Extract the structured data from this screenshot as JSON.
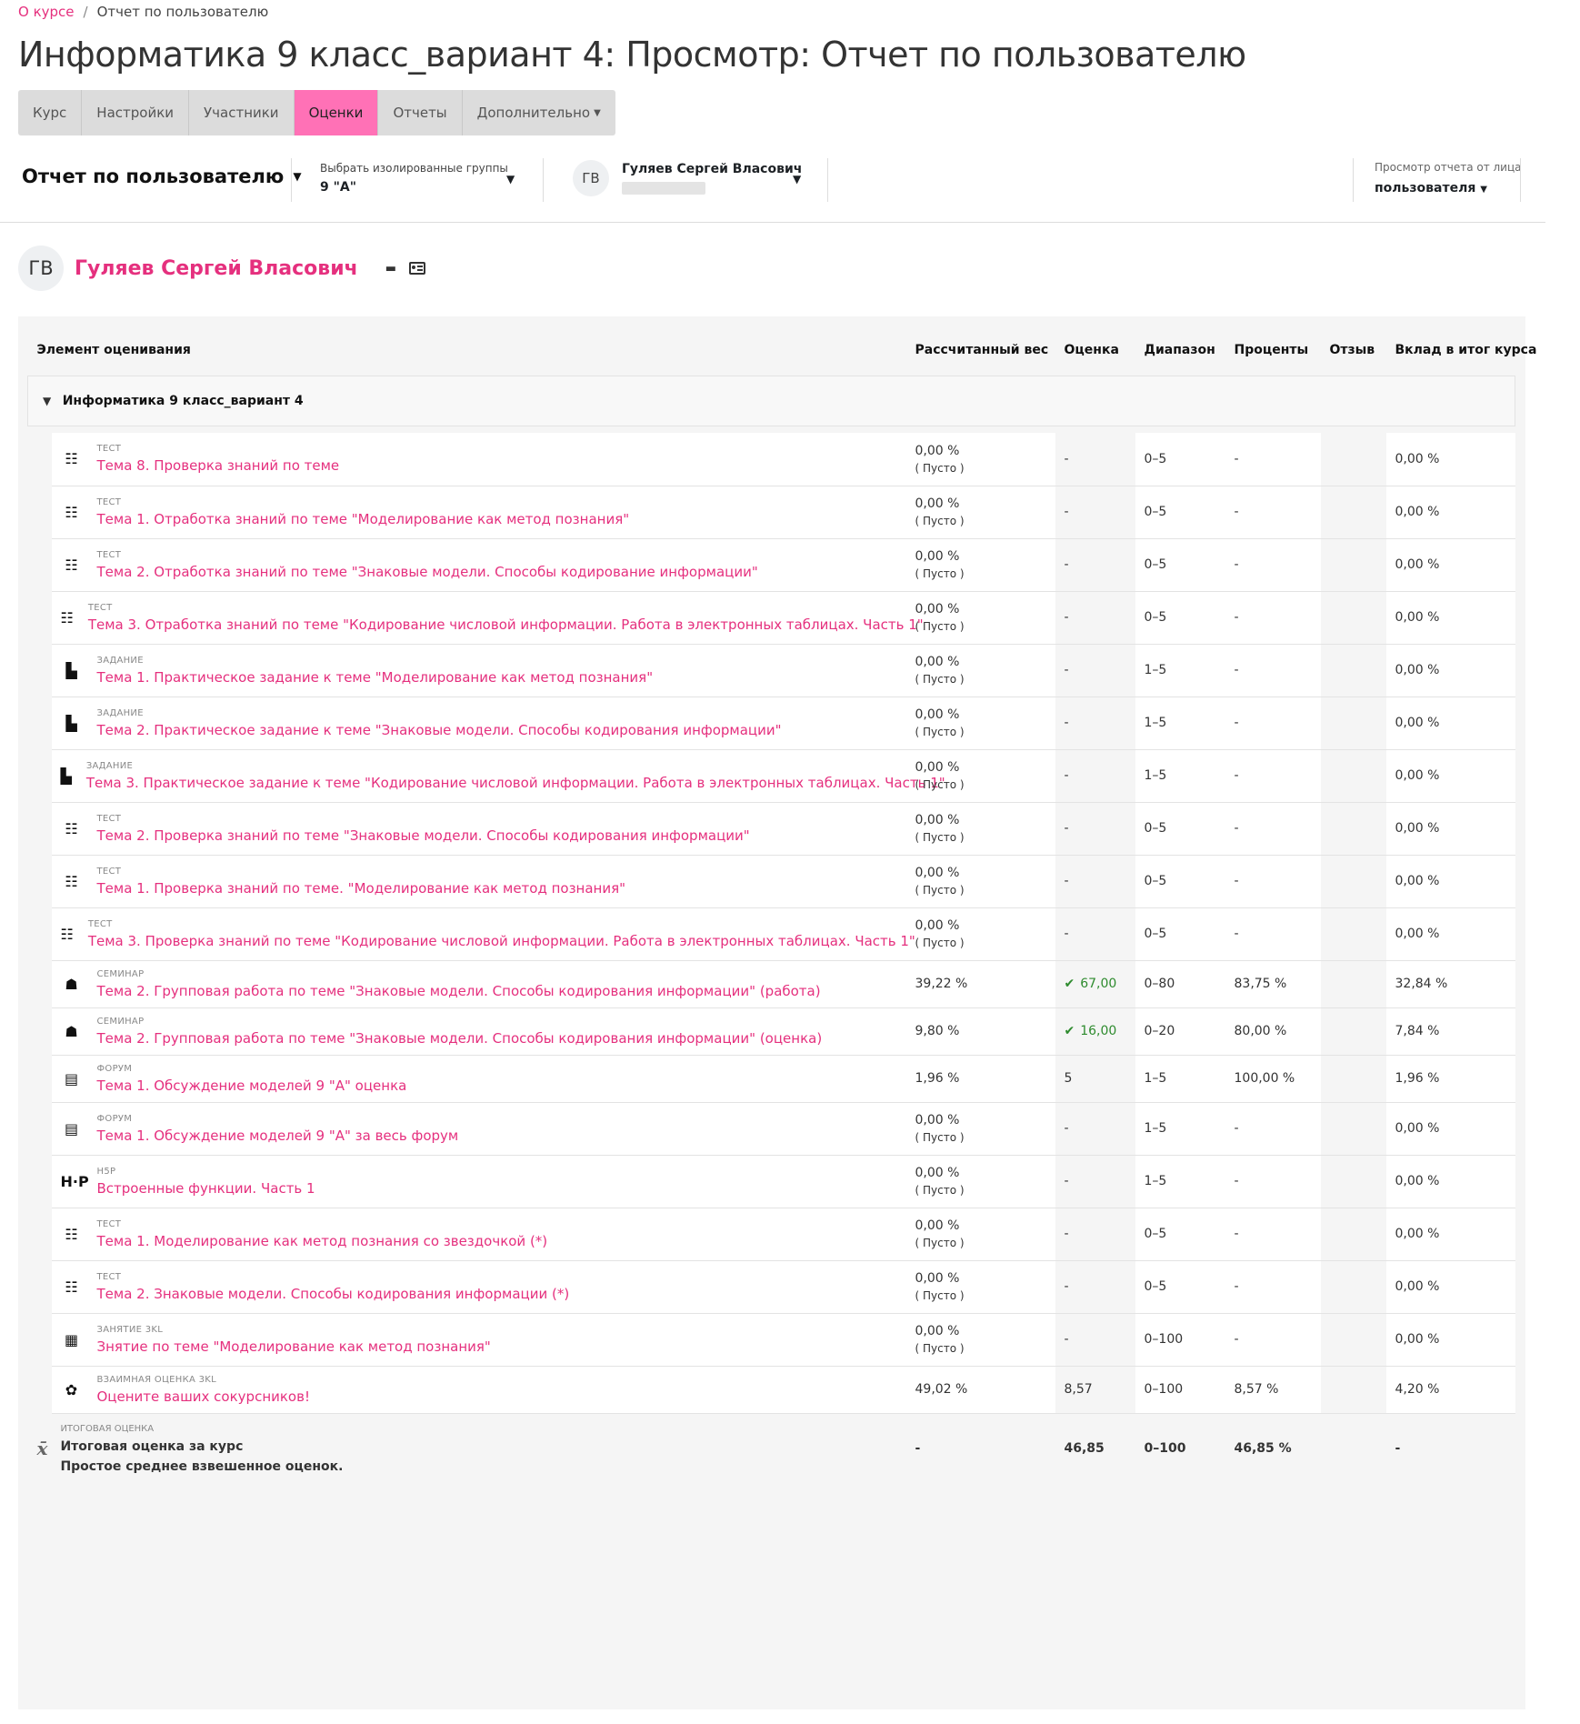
{
  "breadcrumb": {
    "link": "О курсе",
    "separator": "/",
    "current": "Отчет по пользователю"
  },
  "page_title": "Информатика 9 класс_вариант 4: Просмотр: Отчет по пользователю",
  "nav_tabs": [
    {
      "label": "Курс"
    },
    {
      "label": "Настройки"
    },
    {
      "label": "Участники"
    },
    {
      "label": "Оценки",
      "active": true
    },
    {
      "label": "Отчеты"
    },
    {
      "label": "Дополнительно"
    }
  ],
  "toolbar": {
    "report_select": "Отчет по пользователю",
    "group_label": "Выбрать изолированные группы",
    "group_value": "9 \"А\"",
    "user_initials": "ГВ",
    "user_name": "Гуляев Сергей Власович",
    "view_label": "Просмотр отчета от лица",
    "view_value": "пользователя"
  },
  "user_header": {
    "initials": "ГВ",
    "name": "Гуляев Сергей Власович"
  },
  "table": {
    "headers": {
      "item": "Элемент оценивания",
      "weight": "Рассчитанный вес",
      "grade": "Оценка",
      "range": "Диапазон",
      "percent": "Проценты",
      "feedback": "Отзыв",
      "contribution": "Вклад в итог курса"
    },
    "category": "Информатика 9 класс_вариант 4",
    "items": [
      {
        "type": "Тест",
        "icon": "quiz-icon",
        "name": "Тема 8. Проверка знаний по теме",
        "weight": "0,00 %",
        "weight_note": "( Пусто )",
        "grade": "-",
        "range": "0–5",
        "percent": "-",
        "feedback": "",
        "contribution": "0,00 %"
      },
      {
        "type": "Тест",
        "icon": "quiz-icon",
        "name": "Тема 1. Отработка знаний по теме \"Моделирование как метод познания\"",
        "weight": "0,00 %",
        "weight_note": "( Пусто )",
        "grade": "-",
        "range": "0–5",
        "percent": "-",
        "feedback": "",
        "contribution": "0,00 %"
      },
      {
        "type": "Тест",
        "icon": "quiz-icon",
        "name": "Тема 2. Отработка знаний по теме \"Знаковые модели. Способы кодирование информации\"",
        "weight": "0,00 %",
        "weight_note": "( Пусто )",
        "grade": "-",
        "range": "0–5",
        "percent": "-",
        "feedback": "",
        "contribution": "0,00 %"
      },
      {
        "type": "Тест",
        "icon": "quiz-icon",
        "name": "Тема 3. Отработка знаний по теме \"Кодирование числовой информации. Работа в электронных таблицах. Часть 1\"",
        "weight": "0,00 %",
        "weight_note": "( Пусто )",
        "grade": "-",
        "range": "0–5",
        "percent": "-",
        "feedback": "",
        "contribution": "0,00 %"
      },
      {
        "type": "Задание",
        "icon": "assignment-icon",
        "name": "Тема 1. Практическое задание к теме \"Моделирование как метод познания\"",
        "weight": "0,00 %",
        "weight_note": "( Пусто )",
        "grade": "-",
        "range": "1–5",
        "percent": "-",
        "feedback": "",
        "contribution": "0,00 %"
      },
      {
        "type": "Задание",
        "icon": "assignment-icon",
        "name": "Тема 2. Практическое задание к теме \"Знаковые модели. Способы кодирования информации\"",
        "weight": "0,00 %",
        "weight_note": "( Пусто )",
        "grade": "-",
        "range": "1–5",
        "percent": "-",
        "feedback": "",
        "contribution": "0,00 %"
      },
      {
        "type": "Задание",
        "icon": "assignment-icon",
        "name": "Тема 3. Практическое задание к теме \"Кодирование числовой информации. Работа в электронных таблицах. Часть 1\"",
        "weight": "0,00 %",
        "weight_note": "( Пусто )",
        "grade": "-",
        "range": "1–5",
        "percent": "-",
        "feedback": "",
        "contribution": "0,00 %"
      },
      {
        "type": "Тест",
        "icon": "quiz-icon",
        "name": "Тема 2. Проверка знаний по теме \"Знаковые модели. Способы кодирования информации\"",
        "weight": "0,00 %",
        "weight_note": "( Пусто )",
        "grade": "-",
        "range": "0–5",
        "percent": "-",
        "feedback": "",
        "contribution": "0,00 %"
      },
      {
        "type": "Тест",
        "icon": "quiz-icon",
        "name": "Тема 1. Проверка знаний по теме. \"Моделирование как метод познания\"",
        "weight": "0,00 %",
        "weight_note": "( Пусто )",
        "grade": "-",
        "range": "0–5",
        "percent": "-",
        "feedback": "",
        "contribution": "0,00 %"
      },
      {
        "type": "Тест",
        "icon": "quiz-icon",
        "name": "Тема 3. Проверка знаний по теме \"Кодирование числовой информации. Работа в электронных таблицах. Часть 1\"",
        "weight": "0,00 %",
        "weight_note": "( Пусто )",
        "grade": "-",
        "range": "0–5",
        "percent": "-",
        "feedback": "",
        "contribution": "0,00 %"
      },
      {
        "type": "Семинар",
        "icon": "workshop-icon",
        "name": "Тема 2. Групповая работа по теме \"Знаковые модели. Способы кодирования информации\" (работа)",
        "weight": "39,22 %",
        "weight_note": "",
        "grade": "67,00",
        "passed": true,
        "range": "0–80",
        "percent": "83,75 %",
        "feedback": "",
        "contribution": "32,84 %"
      },
      {
        "type": "Семинар",
        "icon": "workshop-icon",
        "name": "Тема 2. Групповая работа по теме \"Знаковые модели. Способы кодирования информации\" (оценка)",
        "weight": "9,80 %",
        "weight_note": "",
        "grade": "16,00",
        "passed": true,
        "range": "0–20",
        "percent": "80,00 %",
        "feedback": "",
        "contribution": "7,84 %"
      },
      {
        "type": "Форум",
        "icon": "forum-icon",
        "name": "Тема 1. Обсуждение моделей 9 \"А\" оценка",
        "weight": "1,96 %",
        "weight_note": "",
        "grade": "5",
        "range": "1–5",
        "percent": "100,00 %",
        "feedback": "",
        "contribution": "1,96 %"
      },
      {
        "type": "Форум",
        "icon": "forum-icon",
        "name": "Тема 1. Обсуждение моделей 9 \"А\" за весь форум",
        "weight": "0,00 %",
        "weight_note": "( Пусто )",
        "grade": "-",
        "range": "1–5",
        "percent": "-",
        "feedback": "",
        "contribution": "0,00 %"
      },
      {
        "type": "H5P",
        "icon": "h5p-icon",
        "name": "Встроенные функции. Часть 1",
        "weight": "0,00 %",
        "weight_note": "( Пусто )",
        "grade": "-",
        "range": "1–5",
        "percent": "-",
        "feedback": "",
        "contribution": "0,00 %"
      },
      {
        "type": "Тест",
        "icon": "quiz-icon",
        "name": "Тема 1. Моделирование как метод познания со звездочкой (*)",
        "weight": "0,00 %",
        "weight_note": "( Пусто )",
        "grade": "-",
        "range": "0–5",
        "percent": "-",
        "feedback": "",
        "contribution": "0,00 %"
      },
      {
        "type": "Тест",
        "icon": "quiz-icon",
        "name": "Тема 2. Знаковые модели. Способы кодирования информации (*)",
        "weight": "0,00 %",
        "weight_note": "( Пусто )",
        "grade": "-",
        "range": "0–5",
        "percent": "-",
        "feedback": "",
        "contribution": "0,00 %"
      },
      {
        "type": "Занятие 3KL",
        "icon": "lesson-icon",
        "name": "Знятие по теме \"Моделирование как метод познания\"",
        "weight": "0,00 %",
        "weight_note": "( Пусто )",
        "grade": "-",
        "range": "0–100",
        "percent": "-",
        "feedback": "",
        "contribution": "0,00 %"
      },
      {
        "type": "Взаимная оценка 3KL",
        "icon": "peer-review-icon",
        "name": "Оцените ваших сокурсников!",
        "weight": "49,02 %",
        "weight_note": "",
        "grade": "8,57",
        "range": "0–100",
        "percent": "8,57 %",
        "feedback": "",
        "contribution": "4,20 %"
      }
    ],
    "total": {
      "type": "Итоговая оценка",
      "title": "Итоговая оценка за курс",
      "subtitle": "Простое среднее взвешенное оценок.",
      "weight": "-",
      "grade": "46,85",
      "range": "0–100",
      "percent": "46,85 %",
      "feedback": "",
      "contribution": "-"
    }
  },
  "colors": {
    "accent": "#e5307e",
    "active_tab": "#ff71b6",
    "pass": "#2e8b2e"
  }
}
